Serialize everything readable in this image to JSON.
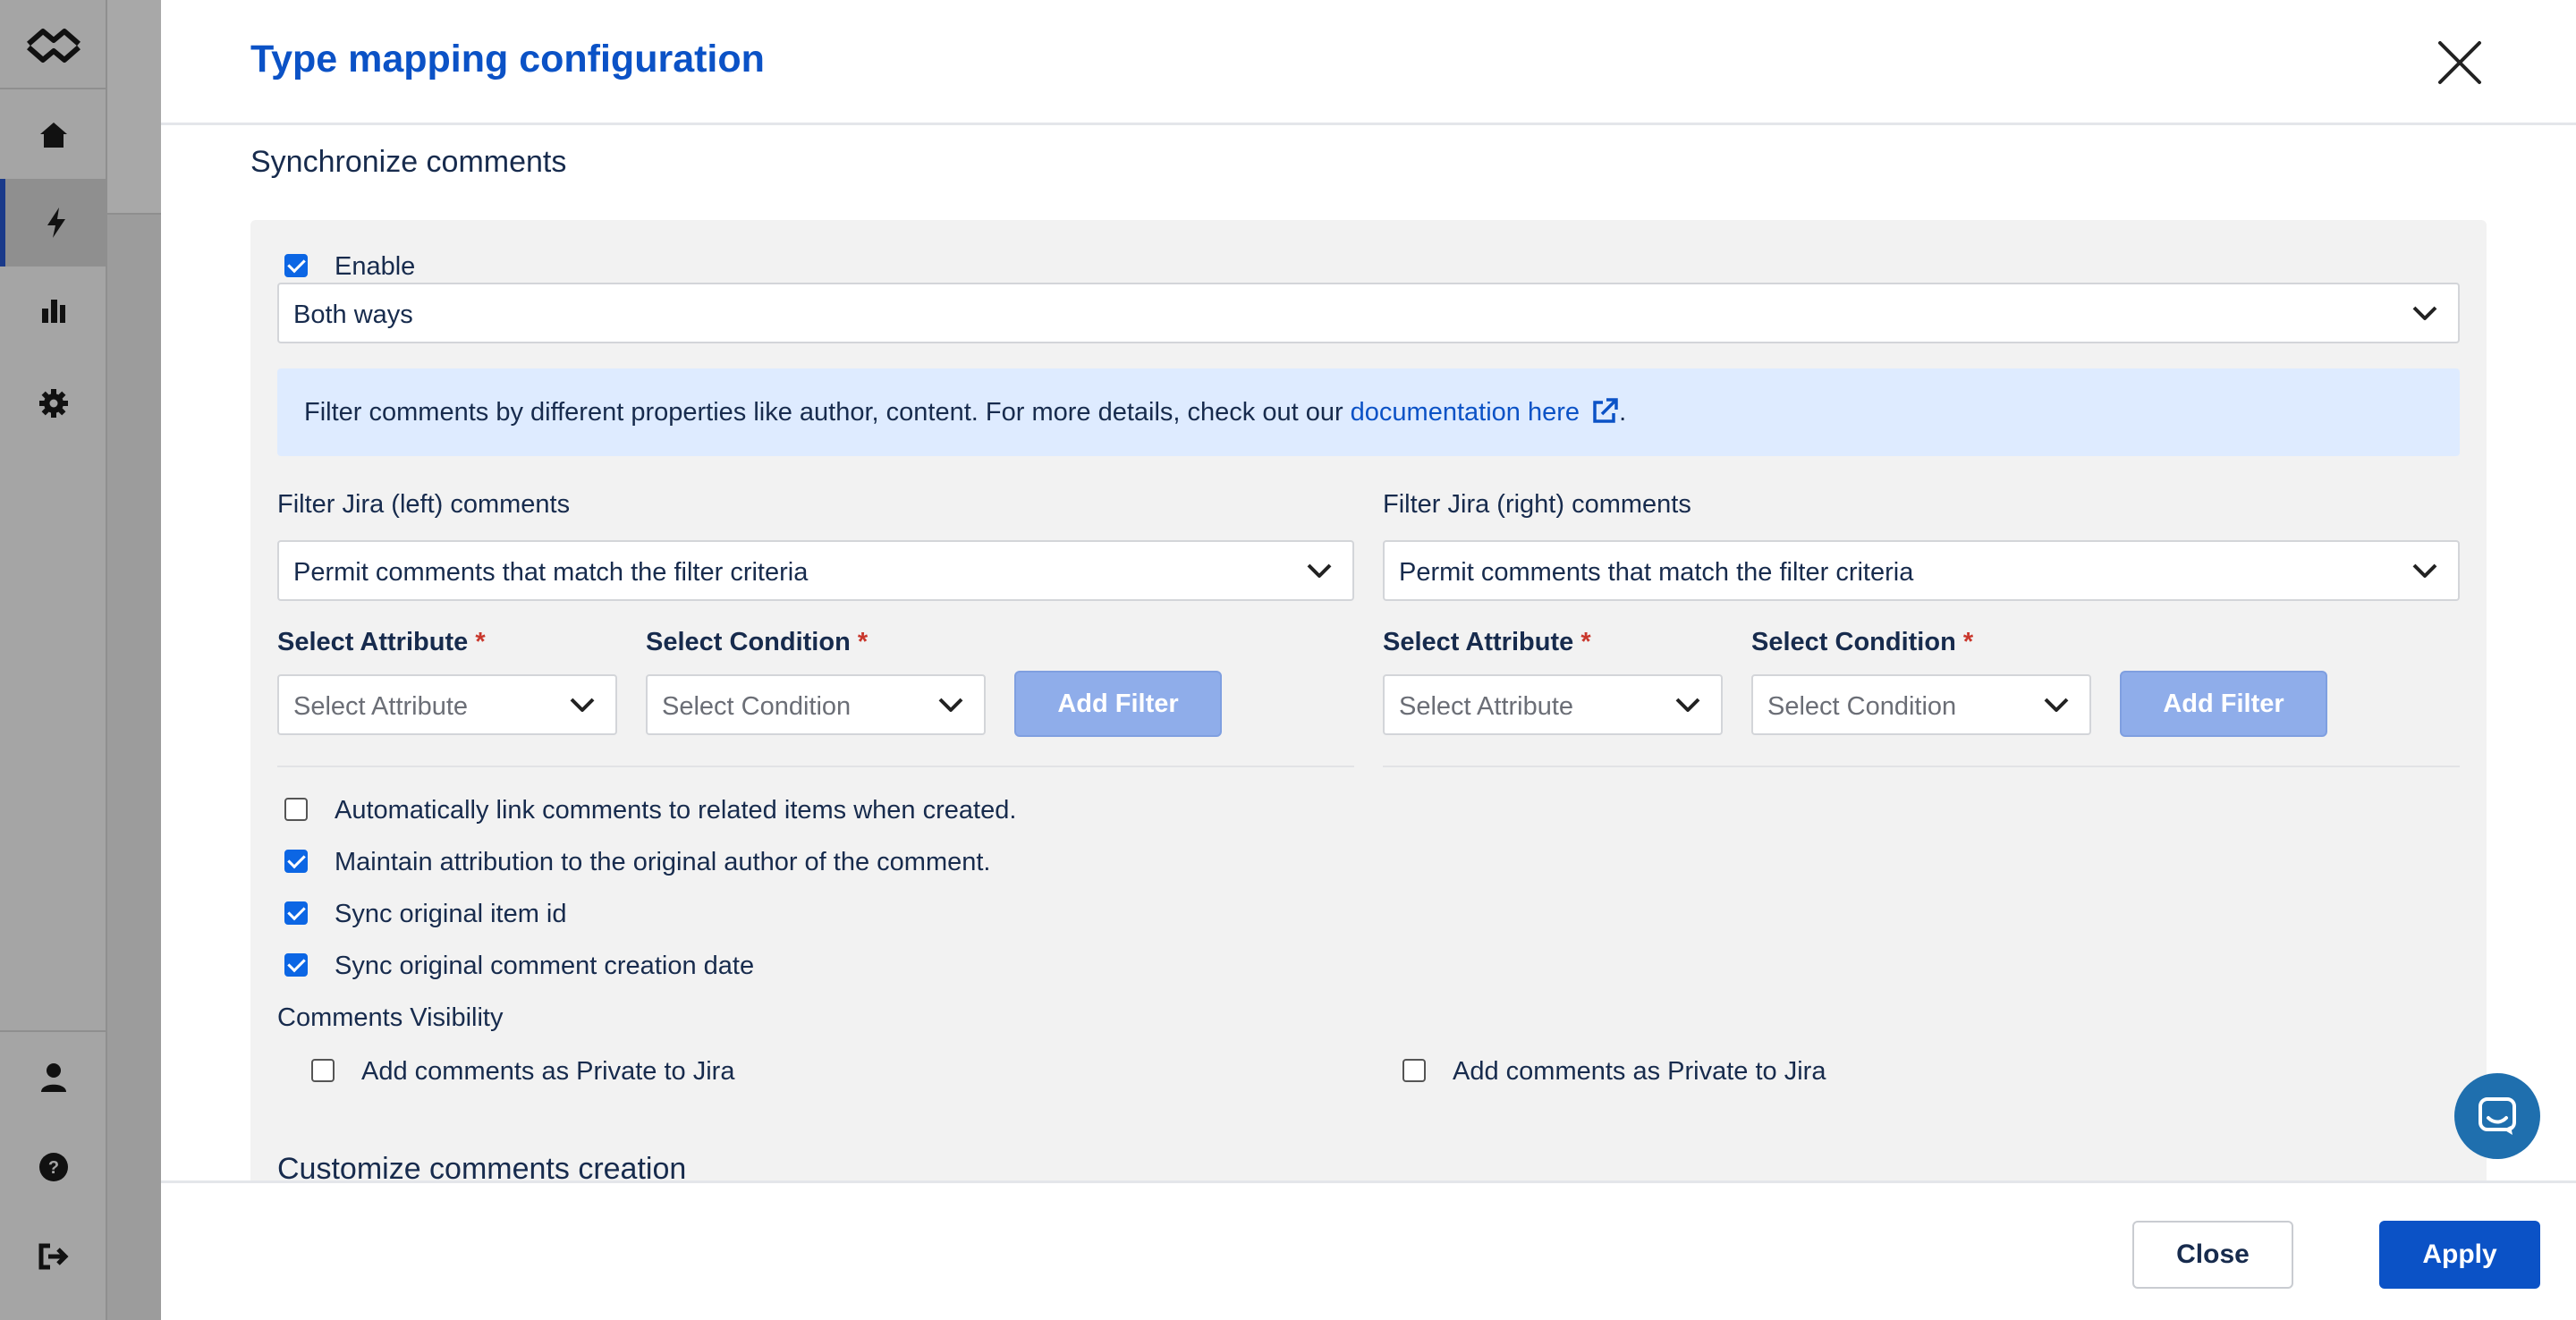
{
  "sidebar": {
    "items": [
      {
        "icon": "home-icon"
      },
      {
        "icon": "bolt-icon",
        "active": true
      },
      {
        "icon": "bar-chart-icon"
      },
      {
        "icon": "gear-icon"
      },
      {
        "icon": "user-icon"
      },
      {
        "icon": "help-icon"
      },
      {
        "icon": "logout-icon"
      }
    ]
  },
  "modal": {
    "title": "Type mapping configuration",
    "section_title": "Synchronize comments",
    "enable_label": "Enable",
    "direction_value": "Both ways",
    "info": {
      "text": "Filter comments by different properties like author, content. For more details, check out our ",
      "link": "documentation here",
      "suffix": "."
    },
    "left_filter": {
      "title": "Filter Jira (left) comments",
      "mode": "Permit comments that match the filter criteria",
      "attribute_label": "Select Attribute",
      "attribute_placeholder": "Select Attribute",
      "condition_label": "Select Condition",
      "condition_placeholder": "Select Condition",
      "add_button": "Add Filter"
    },
    "right_filter": {
      "title": "Filter Jira (right) comments",
      "mode": "Permit comments that match the filter criteria",
      "attribute_label": "Select Attribute",
      "attribute_placeholder": "Select Attribute",
      "condition_label": "Select Condition",
      "condition_placeholder": "Select Condition",
      "add_button": "Add Filter"
    },
    "required_mark": "*",
    "options": [
      {
        "label": "Automatically link comments to related items when created.",
        "checked": false
      },
      {
        "label": "Maintain attribution to the original author of the comment.",
        "checked": true
      },
      {
        "label": "Sync original item id",
        "checked": true
      },
      {
        "label": "Sync original comment creation date",
        "checked": true
      }
    ],
    "visibility_title": "Comments Visibility",
    "private_left": "Add comments as Private to Jira",
    "private_right": "Add comments as Private to Jira",
    "customize_title": "Customize comments creation",
    "close_button": "Close",
    "apply_button": "Apply"
  },
  "colors": {
    "brand": "#0b52c6",
    "checkbox": "#0c66e4",
    "info_bg": "#deebff",
    "add_filter_bg": "#8fadea"
  }
}
